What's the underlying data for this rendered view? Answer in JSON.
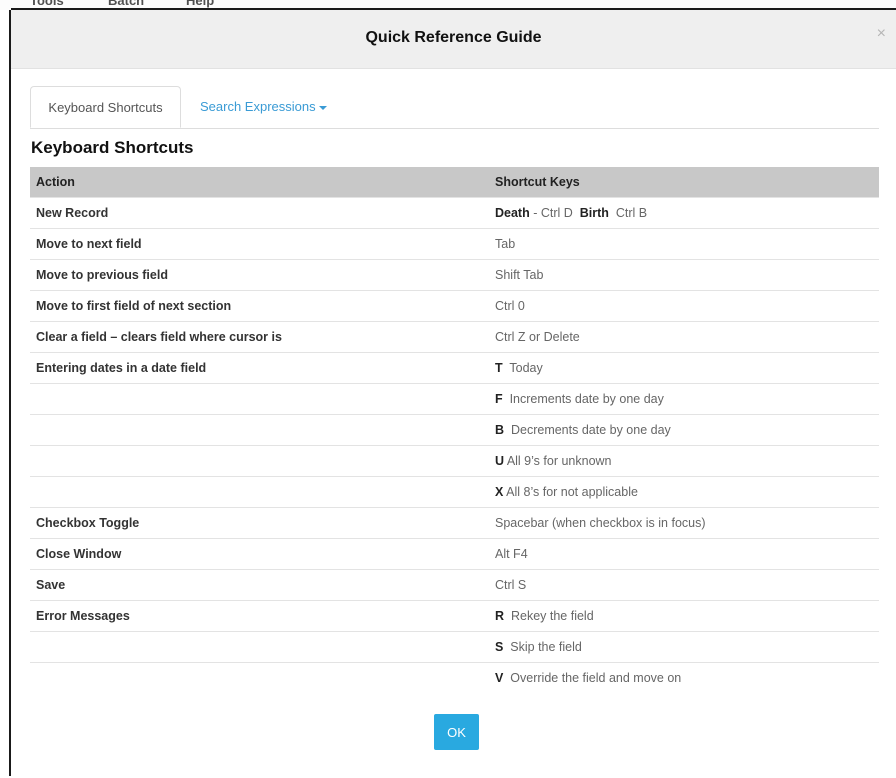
{
  "dialog": {
    "title": "Quick Reference Guide",
    "close_icon": "×",
    "ok_label": "OK"
  },
  "background_menu": [
    "Tools",
    "Batch",
    "Help"
  ],
  "tabs": [
    {
      "label": "Keyboard Shortcuts",
      "active": true
    },
    {
      "label": "Search Expressions",
      "active": false,
      "dropdown": true
    }
  ],
  "section_title": "Keyboard Shortcuts",
  "table": {
    "headers": [
      "Action",
      "Shortcut Keys"
    ],
    "rows": [
      {
        "action": "New Record",
        "keys": [
          {
            "b": "Death"
          },
          {
            "t": " - Ctrl D  "
          },
          {
            "b": "Birth"
          },
          {
            "t": "  Ctrl B"
          }
        ]
      },
      {
        "action": "Move to next field",
        "keys": [
          {
            "t": "Tab"
          }
        ]
      },
      {
        "action": "Move to previous field",
        "keys": [
          {
            "t": "Shift Tab"
          }
        ]
      },
      {
        "action": "Move to first field of next section",
        "keys": [
          {
            "t": "Ctrl 0"
          }
        ]
      },
      {
        "action": "Clear a field – clears field where cursor is",
        "keys": [
          {
            "t": "Ctrl Z or Delete"
          }
        ]
      },
      {
        "action": "Entering dates in a date field",
        "keys": [
          {
            "b": "T"
          },
          {
            "t": "  Today"
          }
        ]
      },
      {
        "action": "",
        "keys": [
          {
            "b": "F"
          },
          {
            "t": "  Increments date by one day"
          }
        ]
      },
      {
        "action": "",
        "keys": [
          {
            "b": "B"
          },
          {
            "t": "  Decrements date by one day"
          }
        ]
      },
      {
        "action": "",
        "keys": [
          {
            "b": "U"
          },
          {
            "t": " All 9’s for unknown"
          }
        ]
      },
      {
        "action": "",
        "keys": [
          {
            "b": "X"
          },
          {
            "t": " All 8’s for not applicable"
          }
        ]
      },
      {
        "action": "Checkbox Toggle",
        "keys": [
          {
            "t": "Spacebar (when checkbox is in focus)"
          }
        ]
      },
      {
        "action": "Close Window",
        "keys": [
          {
            "t": "Alt F4"
          }
        ]
      },
      {
        "action": "Save",
        "keys": [
          {
            "t": "Ctrl S"
          }
        ]
      },
      {
        "action": "Error Messages",
        "keys": [
          {
            "b": "R"
          },
          {
            "t": "  Rekey the field"
          }
        ]
      },
      {
        "action": "",
        "keys": [
          {
            "b": "S"
          },
          {
            "t": "  Skip the field"
          }
        ]
      },
      {
        "action": "",
        "keys": [
          {
            "b": "V"
          },
          {
            "t": "  Override the field and move on"
          }
        ]
      }
    ]
  },
  "colors": {
    "header_bg": "#efefef",
    "table_header_bg": "#c8c8c8",
    "link": "#3a9bd5",
    "ok_button": "#29a9e0"
  }
}
